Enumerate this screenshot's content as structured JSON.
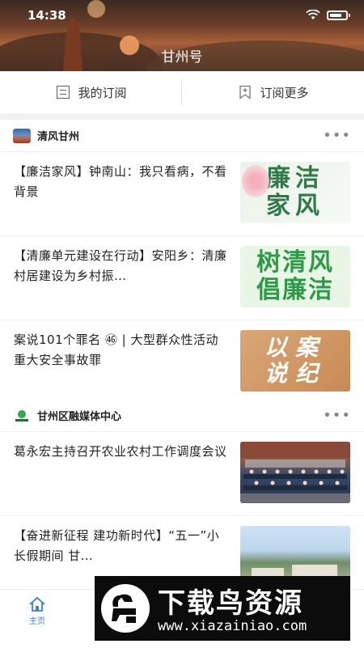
{
  "status": {
    "time": "14:38"
  },
  "header": {
    "title": "甘州号"
  },
  "subscribe": {
    "mine": "我的订阅",
    "more": "订阅更多"
  },
  "channels": [
    {
      "name": "清风甘州",
      "items": [
        {
          "title": "【廉洁家风】钟南山：我只看病，不看背景",
          "thumb_text": [
            "廉洁",
            "家风"
          ]
        },
        {
          "title": "【清廉单元建设在行动】安阳乡：清廉村居建设为乡村振…",
          "thumb_text": [
            "树清风",
            "倡廉洁"
          ]
        },
        {
          "title": "案说101个罪名 ㊻ | 大型群众性活动重大安全事故罪",
          "thumb_text": [
            "以案",
            "说纪"
          ]
        }
      ]
    },
    {
      "name": "甘州区融媒体中心",
      "items": [
        {
          "title": "葛永宏主持召开农业农村工作调度会议"
        },
        {
          "title": "【奋进新征程 建功新时代】“五一”小长假期间 甘…"
        }
      ]
    }
  ],
  "tabbar": {
    "home": "主页"
  },
  "watermark": {
    "title": "下载鸟资源",
    "url": "www.xiazainiao.com"
  },
  "colors": {
    "accent": "#3b7fd6",
    "thumb_green": "#2d9a48"
  }
}
